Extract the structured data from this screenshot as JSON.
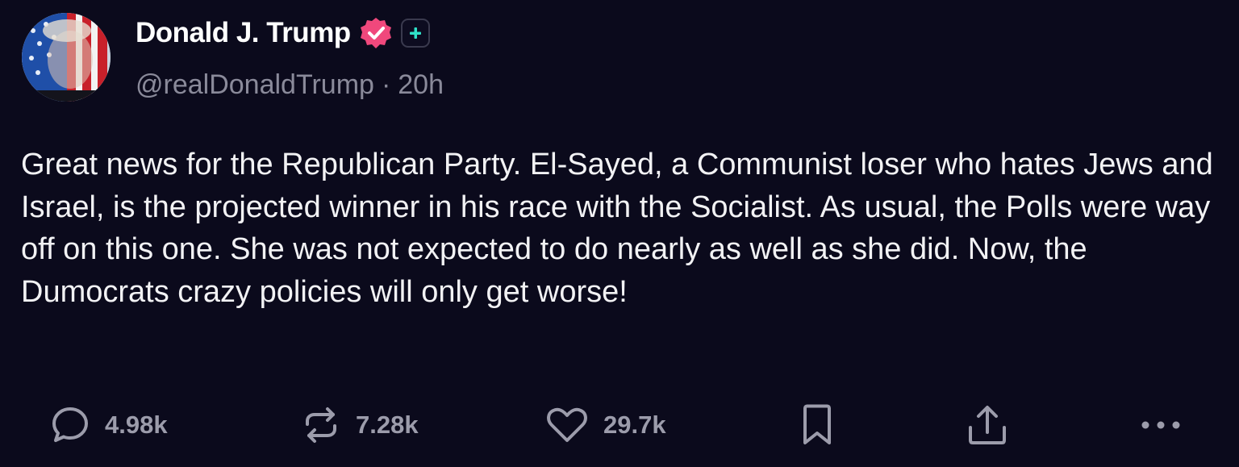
{
  "author": {
    "display_name": "Donald J. Trump",
    "handle": "@realDonaldTrump",
    "separator": "·",
    "time_ago": "20h"
  },
  "post": {
    "text": "Great news for the Republican Party. El-Sayed, a Communist loser who hates Jews and Israel, is the projected winner in his race with the Socialist. As usual, the Polls were way off on this one. She was not expected to do nearly as well as she did. Now, the Dumocrats crazy policies will only get worse!"
  },
  "actions": {
    "replies": "4.98k",
    "reposts": "7.28k",
    "likes": "29.7k"
  },
  "icons": {
    "avatar": "avatar-flag-portrait",
    "verified": "verified-check-icon",
    "plus": "plus-badge-icon",
    "reply": "comment-bubble-icon",
    "repost": "repost-arrows-icon",
    "like": "heart-icon",
    "bookmark": "bookmark-icon",
    "share": "share-upload-icon",
    "more": "more-dots-icon"
  },
  "colors": {
    "background": "#0b0a1c",
    "verified_badge": "#f0487c",
    "plus_badge": "#2fe1c8",
    "muted_text": "#8a8a9a",
    "action_text": "#9c9cab"
  }
}
